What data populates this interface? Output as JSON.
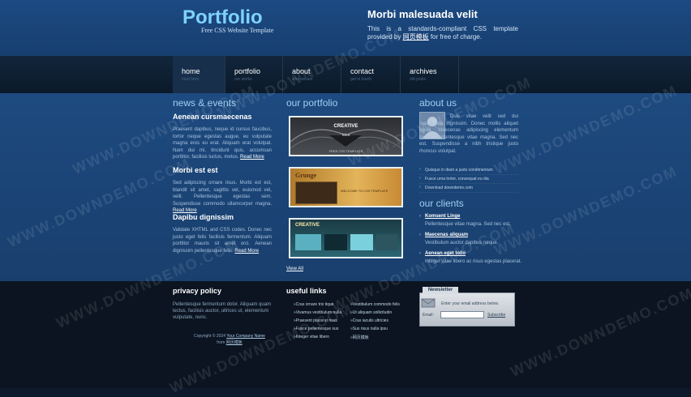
{
  "header": {
    "logo": "Portfolio",
    "logo_sub": "Free CSS Website Template",
    "tag_title": "Morbi malesuada velit",
    "tag_text_1": "This is a standards-compliant CSS template provided by",
    "tag_link": "网页模板",
    "tag_text_2": "for free of charge."
  },
  "nav": {
    "items": [
      {
        "label": "home",
        "sub": "start here"
      },
      {
        "label": "portfolio",
        "sub": "our works"
      },
      {
        "label": "about",
        "sub": "who we are"
      },
      {
        "label": "contact",
        "sub": "get in touch"
      },
      {
        "label": "archives",
        "sub": "old posts"
      }
    ]
  },
  "news": {
    "title": "news & events",
    "posts": [
      {
        "title": "Aenean cursmaecenas",
        "text": "Praesent dapibus, neque id cursus faucibus, tortor neque egestas augue, eu vulputate magna eros eu erat. Aliquam erat volutpat. Nam dui mi, tincidunt quis, accumsan porttitor, facilisis luctus, metus.",
        "more": "Read More"
      },
      {
        "title": "Morbi est est",
        "text": "Sed adipiscing ornare risus. Morbi est est, blandit sit amet, sagittis vel, euismod vel, velit. Pellentesque egestas sem. Suspendisse commodo ullamcorper magna.",
        "more": "Read More"
      },
      {
        "title": "Dapibu dignissim",
        "text": "Validate XHTML and CSS codes. Donec nec justo eget felis facilisis fermentum. Aliquam porttitor mauris sit amet orci. Aenean dignissim pellentesque felis.",
        "more": "Read More"
      }
    ]
  },
  "portfolio": {
    "title": "our portfolio",
    "thumb1_title": "CREATIVE",
    "thumb1_sub": "Idea",
    "thumb1_foot": "FREE CSS TEMPLATE",
    "thumb2_brand": "Grunge",
    "thumb2_caption": "WELCOME TO CSS TEMPLATE",
    "thumb3_title": "CREATIVE",
    "view_all": "View All"
  },
  "about": {
    "title": "about us",
    "text": "Duis vitae velit sed dui malesuada dignissim. Donec mollis aliquet ligula. Maecenas adipiscing elementum ipsum. Pellentesque vitae magna. Sed nec est. Suspendisse a nibh tristique justo rhoncus volutpat.",
    "bullets": [
      "Quisque in diam a justo condimentum",
      "Fusce urna tortor, consequat eu dia",
      "Download downdemo.com"
    ]
  },
  "clients": {
    "title": "our clients",
    "items": [
      {
        "name": "Komsent Linge",
        "desc": "Pellentesque vitae magna. Sed nec est."
      },
      {
        "name": "Maecenas aliquam",
        "desc": "Vestibulum auctor dapibus neque."
      },
      {
        "name": "Aenean eget tollo",
        "desc": "Integer vitae libero ac risus egestas placerat."
      }
    ]
  },
  "footer": {
    "privacy_title": "privacy policy",
    "privacy_text": "Pellentesque fermentum dolor. Aliquam quam lectus, facilisis auctor, ultrices ut, elementum vulputate, nunc.",
    "copyright_1": "Copyright © 2024",
    "copyright_link": "Your Company Name",
    "copyright_2": "from",
    "copyright_link2": "网页模板",
    "links_title": "useful links",
    "links_col1": [
      "Cras ornare tris tique",
      "Vivamus vestibulum nulla",
      "Praesent placerat risus",
      "Fusce pellentesque sus",
      "Integer vitae libero"
    ],
    "links_col2": [
      "Vestibulum commodo felis",
      "Ut aliquam sollicitudin",
      "Cras iaculis ultricies",
      "Sus risus nulla ipsu",
      "网页模板"
    ],
    "newsletter_tab": "Newsletter",
    "newsletter_desc": "Enter your email address below.",
    "newsletter_label": "Email:",
    "newsletter_button": "Subscribe"
  },
  "watermark": "WWW.DOWNDEMO.COM"
}
